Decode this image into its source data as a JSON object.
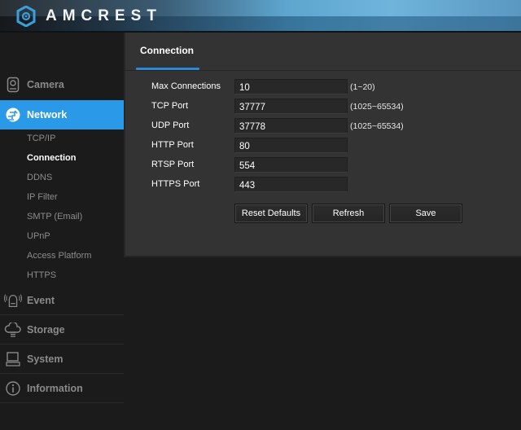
{
  "header": {
    "brand": "AMCREST"
  },
  "sidebar": {
    "main_items": [
      {
        "label": "Camera",
        "icon": "camera-icon",
        "active": false
      },
      {
        "label": "Network",
        "icon": "globe-network-icon",
        "active": true
      },
      {
        "label": "Event",
        "icon": "alarm-icon",
        "active": false
      },
      {
        "label": "Storage",
        "icon": "cloud-storage-icon",
        "active": false
      },
      {
        "label": "System",
        "icon": "monitor-icon",
        "active": false
      },
      {
        "label": "Information",
        "icon": "info-icon",
        "active": false
      }
    ],
    "network_sub_items": [
      {
        "label": "TCP/IP",
        "active": false
      },
      {
        "label": "Connection",
        "active": true
      },
      {
        "label": "DDNS",
        "active": false
      },
      {
        "label": "IP Filter",
        "active": false
      },
      {
        "label": "SMTP (Email)",
        "active": false
      },
      {
        "label": "UPnP",
        "active": false
      },
      {
        "label": "Access Platform",
        "active": false
      },
      {
        "label": "HTTPS",
        "active": false
      }
    ]
  },
  "panel": {
    "tab_title": "Connection",
    "fields": [
      {
        "label": "Max Connections",
        "value": "10",
        "range": "(1~20)"
      },
      {
        "label": "TCP Port",
        "value": "37777",
        "range": "(1025~65534)"
      },
      {
        "label": "UDP Port",
        "value": "37778",
        "range": "(1025~65534)"
      },
      {
        "label": "HTTP Port",
        "value": "80",
        "range": ""
      },
      {
        "label": "RTSP Port",
        "value": "554",
        "range": ""
      },
      {
        "label": "HTTPS Port",
        "value": "443",
        "range": ""
      }
    ],
    "buttons": {
      "reset": "Reset Defaults",
      "refresh": "Refresh",
      "save": "Save"
    }
  },
  "colors": {
    "accent": "#2a9ae8",
    "tab_underline": "#2a8ad8",
    "panel_bg": "#333333",
    "page_bg": "#1b1b1b"
  }
}
